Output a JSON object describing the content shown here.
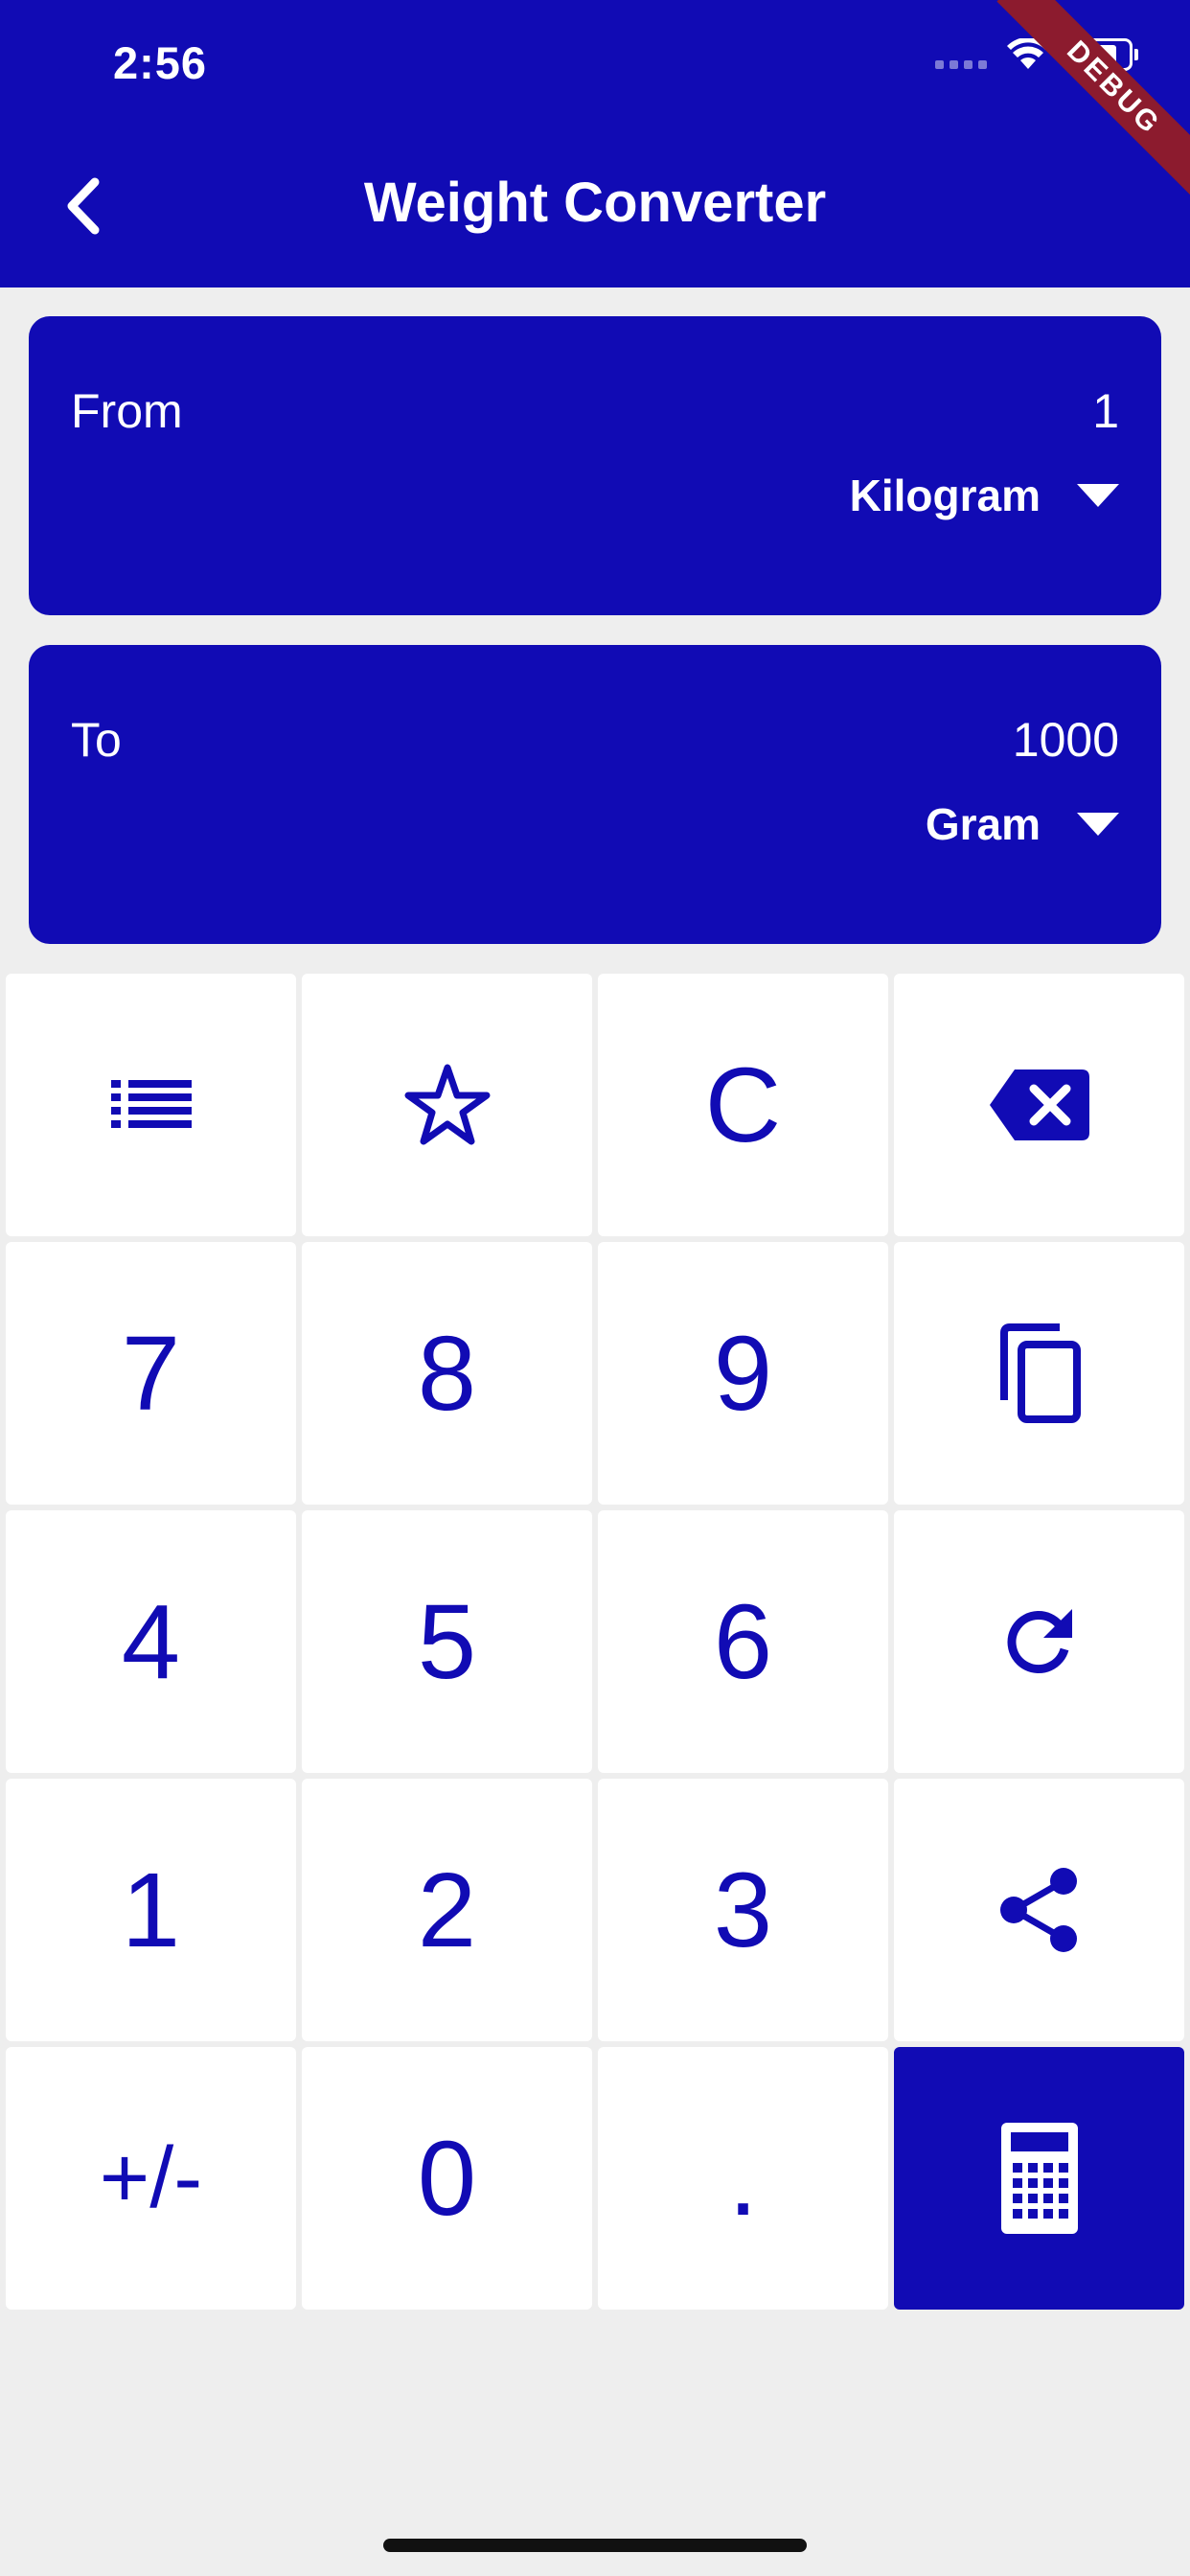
{
  "status": {
    "time": "2:56",
    "ribbon": "DEBUG"
  },
  "header": {
    "title": "Weight Converter",
    "back_icon": "chevron-left-icon"
  },
  "from": {
    "label": "From",
    "value": "1",
    "unit": "Kilogram"
  },
  "to": {
    "label": "To",
    "value": "1000",
    "unit": "Gram"
  },
  "keypad": {
    "k7": "7",
    "k8": "8",
    "k9": "9",
    "k4": "4",
    "k5": "5",
    "k6": "6",
    "k1": "1",
    "k2": "2",
    "k3": "3",
    "sign": "+/-",
    "k0": "0",
    "dot": ".",
    "clear": "C"
  },
  "colors": {
    "primary": "#110bb4",
    "background": "#eeeeee",
    "key_bg": "#ffffff",
    "ribbon": "#8c1b2e"
  }
}
